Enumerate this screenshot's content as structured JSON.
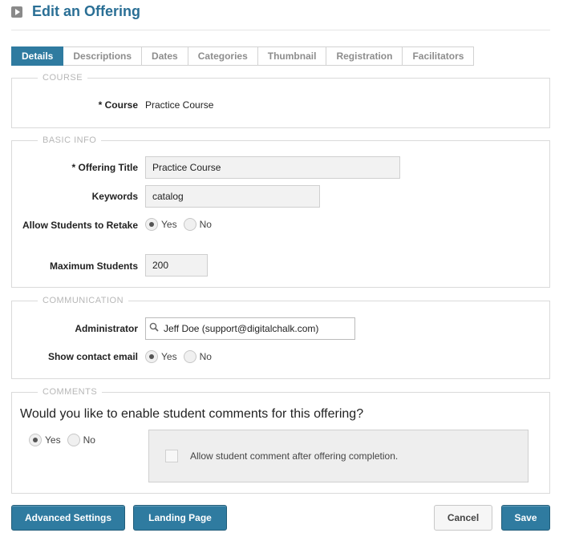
{
  "page": {
    "title": "Edit an Offering"
  },
  "tabs": [
    {
      "label": "Details",
      "active": true
    },
    {
      "label": "Descriptions"
    },
    {
      "label": "Dates"
    },
    {
      "label": "Categories"
    },
    {
      "label": "Thumbnail"
    },
    {
      "label": "Registration"
    },
    {
      "label": "Facilitators"
    }
  ],
  "course": {
    "legend": "COURSE",
    "label": "* Course",
    "value": "Practice Course"
  },
  "basic_info": {
    "legend": "BASIC INFO",
    "offering_title_label": "* Offering Title",
    "offering_title_value": "Practice Course",
    "keywords_label": "Keywords",
    "keywords_value": "catalog",
    "allow_retake_label": "Allow Students to Retake",
    "allow_retake_yes": "Yes",
    "allow_retake_no": "No",
    "max_students_label": "Maximum Students",
    "max_students_value": "200"
  },
  "communication": {
    "legend": "COMMUNICATION",
    "administrator_label": "Administrator",
    "administrator_value": "Jeff Doe (support@digitalchalk.com)",
    "show_email_label": "Show contact email",
    "show_email_yes": "Yes",
    "show_email_no": "No"
  },
  "comments": {
    "legend": "COMMENTS",
    "question": "Would you like to enable student comments for this offering?",
    "yes": "Yes",
    "no": "No",
    "checkbox_label": "Allow student comment after offering completion."
  },
  "buttons": {
    "advanced_settings": "Advanced Settings",
    "landing_page": "Landing Page",
    "cancel": "Cancel",
    "save": "Save"
  },
  "colors": {
    "accent": "#2f7ba0",
    "title": "#2a6f95"
  }
}
